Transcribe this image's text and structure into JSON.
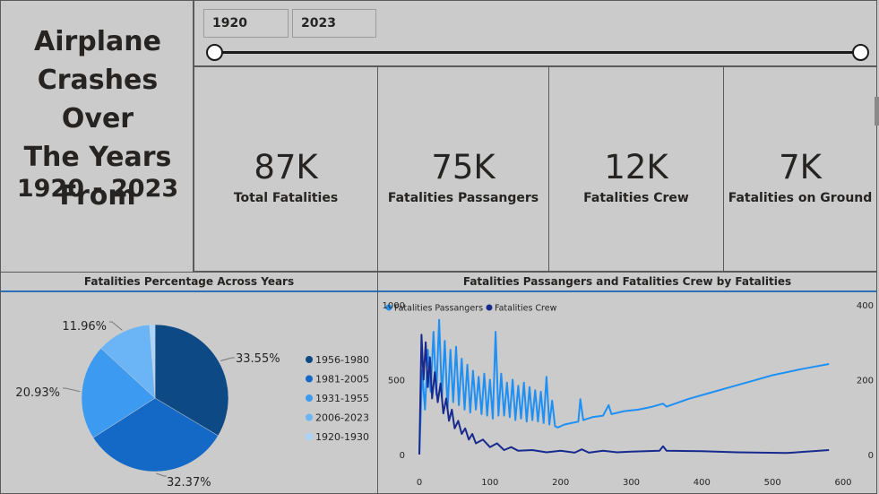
{
  "title": {
    "line1": "Airplane",
    "line2": "Crashes Over",
    "line3": "The Years",
    "line4": "From",
    "range": "1920 - 2023"
  },
  "slicer": {
    "start_year": "1920",
    "end_year": "2023"
  },
  "kpis": [
    {
      "value": "87K",
      "label": "Total Fatalities"
    },
    {
      "value": "75K",
      "label": "Fatalities Passangers"
    },
    {
      "value": "12K",
      "label": "Fatalities Crew"
    },
    {
      "value": "7K",
      "label": "Fatalities on Ground"
    }
  ],
  "pie_chart": {
    "title": "Fatalities Percentage Across Years",
    "chart_data": {
      "type": "pie",
      "slices": [
        {
          "label": "1956-1980",
          "value": 33.55,
          "display": "33.55%",
          "color": "#0d4a85"
        },
        {
          "label": "1981-2005",
          "value": 32.37,
          "display": "32.37%",
          "color": "#1469c6"
        },
        {
          "label": "1931-1955",
          "value": 20.93,
          "display": "20.93%",
          "color": "#3c9af0"
        },
        {
          "label": "2006-2023",
          "value": 11.96,
          "display": "11.96%",
          "color": "#6bb5f7"
        },
        {
          "label": "1920-1930",
          "value": 1.19,
          "display": "",
          "color": "#a9d4fb"
        }
      ],
      "legend_position": "right"
    }
  },
  "line_chart": {
    "title": "Fatalities Passangers and Fatalities Crew by Fatalities",
    "chart_data": {
      "type": "line",
      "xlim": [
        0,
        600
      ],
      "x_ticks": [
        "0",
        "100",
        "200",
        "300",
        "400",
        "500",
        "600"
      ],
      "y_left_ticks": [
        "0",
        "500",
        "1000"
      ],
      "y_right_ticks": [
        "0",
        "200",
        "400"
      ],
      "ylim_left": [
        0,
        1000
      ],
      "ylim_right": [
        0,
        400
      ],
      "series": [
        {
          "name": "Fatalities Passangers",
          "axis": "left",
          "color": "#1e90f5",
          "points": [
            [
              0,
              0
            ],
            [
              4,
              560
            ],
            [
              8,
              300
            ],
            [
              12,
              700
            ],
            [
              16,
              420
            ],
            [
              20,
              820
            ],
            [
              24,
              400
            ],
            [
              28,
              900
            ],
            [
              32,
              380
            ],
            [
              36,
              760
            ],
            [
              40,
              300
            ],
            [
              44,
              700
            ],
            [
              48,
              350
            ],
            [
              52,
              720
            ],
            [
              56,
              330
            ],
            [
              60,
              640
            ],
            [
              64,
              300
            ],
            [
              68,
              600
            ],
            [
              72,
              280
            ],
            [
              76,
              560
            ],
            [
              80,
              300
            ],
            [
              84,
              520
            ],
            [
              88,
              270
            ],
            [
              92,
              540
            ],
            [
              96,
              260
            ],
            [
              100,
              500
            ],
            [
              104,
              240
            ],
            [
              108,
              820
            ],
            [
              112,
              260
            ],
            [
              116,
              540
            ],
            [
              120,
              260
            ],
            [
              124,
              480
            ],
            [
              128,
              250
            ],
            [
              132,
              500
            ],
            [
              136,
              230
            ],
            [
              140,
              460
            ],
            [
              144,
              240
            ],
            [
              148,
              480
            ],
            [
              152,
              220
            ],
            [
              156,
              450
            ],
            [
              160,
              230
            ],
            [
              164,
              430
            ],
            [
              168,
              220
            ],
            [
              172,
              420
            ],
            [
              176,
              210
            ],
            [
              180,
              520
            ],
            [
              184,
              200
            ],
            [
              188,
              360
            ],
            [
              192,
              190
            ],
            [
              196,
              180
            ],
            [
              205,
              200
            ],
            [
              215,
              210
            ],
            [
              225,
              220
            ],
            [
              228,
              370
            ],
            [
              232,
              230
            ],
            [
              245,
              250
            ],
            [
              260,
              260
            ],
            [
              268,
              330
            ],
            [
              272,
              270
            ],
            [
              290,
              290
            ],
            [
              310,
              300
            ],
            [
              330,
              320
            ],
            [
              345,
              340
            ],
            [
              350,
              320
            ],
            [
              380,
              370
            ],
            [
              410,
              410
            ],
            [
              440,
              450
            ],
            [
              470,
              490
            ],
            [
              500,
              530
            ],
            [
              540,
              570
            ],
            [
              580,
              605
            ]
          ]
        },
        {
          "name": "Fatalities Crew",
          "axis": "right",
          "color": "#182a8e",
          "points": [
            [
              0,
              0
            ],
            [
              3,
              320
            ],
            [
              6,
              200
            ],
            [
              9,
              300
            ],
            [
              12,
              180
            ],
            [
              15,
              260
            ],
            [
              18,
              150
            ],
            [
              22,
              220
            ],
            [
              26,
              140
            ],
            [
              30,
              190
            ],
            [
              34,
              110
            ],
            [
              38,
              150
            ],
            [
              42,
              90
            ],
            [
              46,
              120
            ],
            [
              50,
              70
            ],
            [
              55,
              90
            ],
            [
              60,
              55
            ],
            [
              65,
              70
            ],
            [
              70,
              40
            ],
            [
              75,
              55
            ],
            [
              80,
              30
            ],
            [
              90,
              40
            ],
            [
              100,
              20
            ],
            [
              110,
              30
            ],
            [
              120,
              12
            ],
            [
              130,
              20
            ],
            [
              140,
              10
            ],
            [
              160,
              12
            ],
            [
              180,
              6
            ],
            [
              200,
              10
            ],
            [
              220,
              5
            ],
            [
              230,
              14
            ],
            [
              240,
              5
            ],
            [
              260,
              10
            ],
            [
              280,
              6
            ],
            [
              300,
              8
            ],
            [
              340,
              10
            ],
            [
              345,
              22
            ],
            [
              350,
              10
            ],
            [
              400,
              9
            ],
            [
              450,
              6
            ],
            [
              520,
              4
            ],
            [
              580,
              12
            ]
          ]
        }
      ]
    }
  }
}
